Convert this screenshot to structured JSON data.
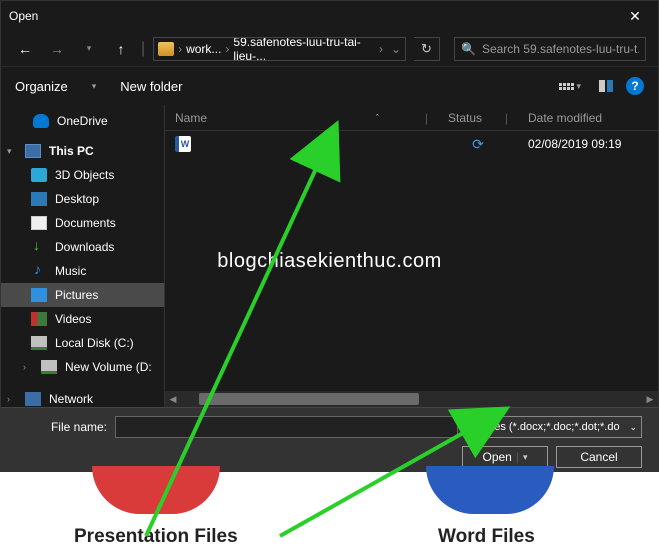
{
  "dialog": {
    "title": "Open",
    "breadcrumb": {
      "seg1": "work...",
      "seg2": "59.safenotes-luu-tru-tai-lieu-..."
    },
    "search_placeholder": "Search 59.safenotes-luu-tru-t...",
    "organize": "Organize",
    "new_folder": "New folder"
  },
  "sidebar": {
    "items": [
      {
        "label": "OneDrive"
      },
      {
        "label": "This PC"
      },
      {
        "label": "3D Objects"
      },
      {
        "label": "Desktop"
      },
      {
        "label": "Documents"
      },
      {
        "label": "Downloads"
      },
      {
        "label": "Music"
      },
      {
        "label": "Pictures"
      },
      {
        "label": "Videos"
      },
      {
        "label": "Local Disk (C:)"
      },
      {
        "label": "New Volume (D:"
      },
      {
        "label": "Network"
      }
    ]
  },
  "columns": {
    "name": "Name",
    "status": "Status",
    "date": "Date modified"
  },
  "files": [
    {
      "name": " ",
      "status": "⟳",
      "date": "02/08/2019 09:19"
    }
  ],
  "watermark": "blogchiasekienthuc.com",
  "bottom": {
    "filename_label": "File name:",
    "filetype": "All files (*.docx;*.doc;*.dot;*.do",
    "open": "Open",
    "cancel": "Cancel"
  },
  "footer": {
    "left": "Presentation Files",
    "right": "Word Files"
  }
}
